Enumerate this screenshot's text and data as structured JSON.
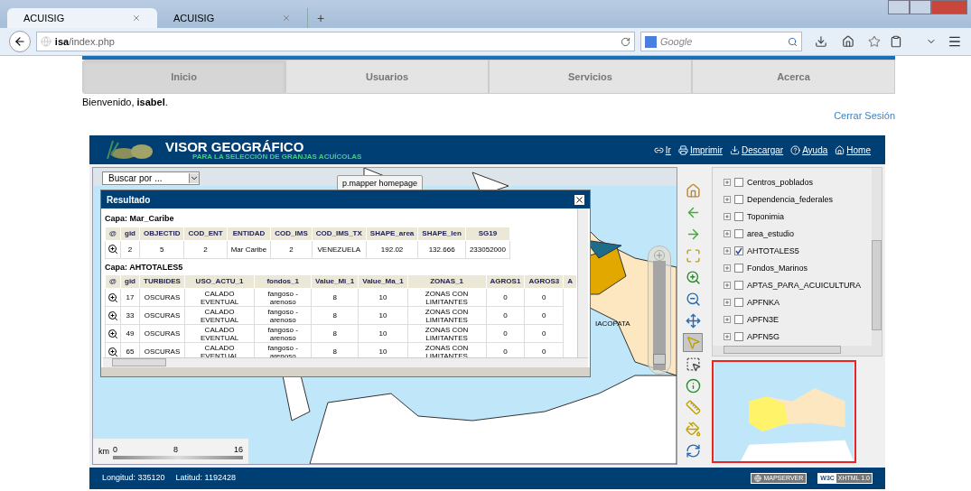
{
  "browser": {
    "tabs": [
      {
        "title": "ACUISIG",
        "selected": true
      },
      {
        "title": "ACUISIG",
        "selected": false
      }
    ],
    "new_tab": "+",
    "address": {
      "host": "isa",
      "path": "/index.php"
    },
    "search": {
      "placeholder": "Google"
    }
  },
  "nav": [
    {
      "label": "Inicio",
      "selected": true
    },
    {
      "label": "Usuarios",
      "selected": false
    },
    {
      "label": "Servicios",
      "selected": false
    },
    {
      "label": "Acerca",
      "selected": false
    }
  ],
  "welcome": "Bienvenido, **isabel**.",
  "logout": "Cerrar Sesión",
  "viewer": {
    "title": "VISOR GEOGRÁFICO",
    "subtitle": "PARA LA SELECCIÓN DE GRANJAS ACUÍCOLAS",
    "links": [
      {
        "kind": "go",
        "label": "Ir"
      },
      {
        "kind": "print",
        "label": "Imprimir"
      },
      {
        "kind": "download",
        "label": "Descargar"
      },
      {
        "kind": "help",
        "label": "Ayuda"
      },
      {
        "kind": "home",
        "label": "Home"
      }
    ],
    "search_select": "Buscar por ...",
    "tooltip": "p.mapper homepage",
    "map_label": "IACOPATA",
    "zoom_slider": {
      "level": 0.05
    },
    "scale": {
      "unit": "km",
      "ticks": [
        "0",
        "8",
        "16"
      ]
    },
    "result": {
      "title": "Resultado",
      "layers": [
        {
          "name": "Capa: Mar_Caribe",
          "action_header": "@",
          "columns": [
            "gid",
            "OBJECTID",
            "COD_ENT",
            "ENTIDAD",
            "COD_IMS",
            "COD_IMS_TX",
            "SHAPE_area",
            "SHAPE_len",
            "SG19"
          ],
          "rows": [
            [
              "2",
              "5",
              "2",
              "Mar Caribe",
              "2",
              "VENEZUELA",
              "192.02",
              "132.666",
              "233052000"
            ]
          ]
        },
        {
          "name": "Capa: AHTOTALES5",
          "action_header": "@",
          "columns": [
            "gid",
            "TURBIDES",
            "USO_ACTU_1",
            "fondos_1",
            "Value_Mi_1",
            "Value_Ma_1",
            "ZONAS_1",
            "AGROS1",
            "AGROS3",
            "A"
          ],
          "rows": [
            [
              "17",
              "OSCURAS",
              "CALADO EVENTUAL",
              "fangoso - arenoso",
              "8",
              "10",
              "ZONAS CON LIMITANTES",
              "0",
              "0"
            ],
            [
              "33",
              "OSCURAS",
              "CALADO EVENTUAL",
              "fangoso - arenoso",
              "8",
              "10",
              "ZONAS CON LIMITANTES",
              "0",
              "0"
            ],
            [
              "49",
              "OSCURAS",
              "CALADO EVENTUAL",
              "fangoso - arenoso",
              "8",
              "10",
              "ZONAS CON LIMITANTES",
              "0",
              "0"
            ],
            [
              "65",
              "OSCURAS",
              "CALADO EVENTUAL",
              "fangoso - arenoso",
              "8",
              "10",
              "ZONAS CON LIMITANTES",
              "0",
              "0"
            ]
          ]
        }
      ]
    },
    "tools": [
      {
        "kind": "home",
        "selected": false
      },
      {
        "kind": "back",
        "selected": false
      },
      {
        "kind": "forward",
        "selected": false
      },
      {
        "kind": "extent",
        "selected": false
      },
      {
        "kind": "zoomin",
        "selected": false
      },
      {
        "kind": "zoomout",
        "selected": false
      },
      {
        "kind": "pan",
        "selected": false
      },
      {
        "kind": "identify",
        "selected": true
      },
      {
        "kind": "select",
        "selected": false
      },
      {
        "kind": "info",
        "selected": false
      },
      {
        "kind": "measure",
        "selected": false
      },
      {
        "kind": "paint",
        "selected": false
      },
      {
        "kind": "refresh",
        "selected": false
      }
    ],
    "layers": [
      {
        "name": "Centros_poblados",
        "checked": false
      },
      {
        "name": "Dependencia_federales",
        "checked": false
      },
      {
        "name": "Toponimia",
        "checked": false
      },
      {
        "name": "area_estudio",
        "checked": false
      },
      {
        "name": "AHTOTALES5",
        "checked": true
      },
      {
        "name": "Fondos_Marinos",
        "checked": false
      },
      {
        "name": "APTAS_PARA_ACUICULTURA",
        "checked": false
      },
      {
        "name": "APFNKA",
        "checked": false
      },
      {
        "name": "APFN3E",
        "checked": false
      },
      {
        "name": "APFN5G",
        "checked": false
      }
    ],
    "footer": {
      "longitude": "Longitud: 335120",
      "latitude": "Latitud: 1192428",
      "badges": [
        {
          "kind": "mapserver",
          "label": "MAPSERVER"
        },
        {
          "kind": "w3c",
          "mark": "W3C",
          "label": "XHTML 1.0"
        }
      ]
    }
  }
}
